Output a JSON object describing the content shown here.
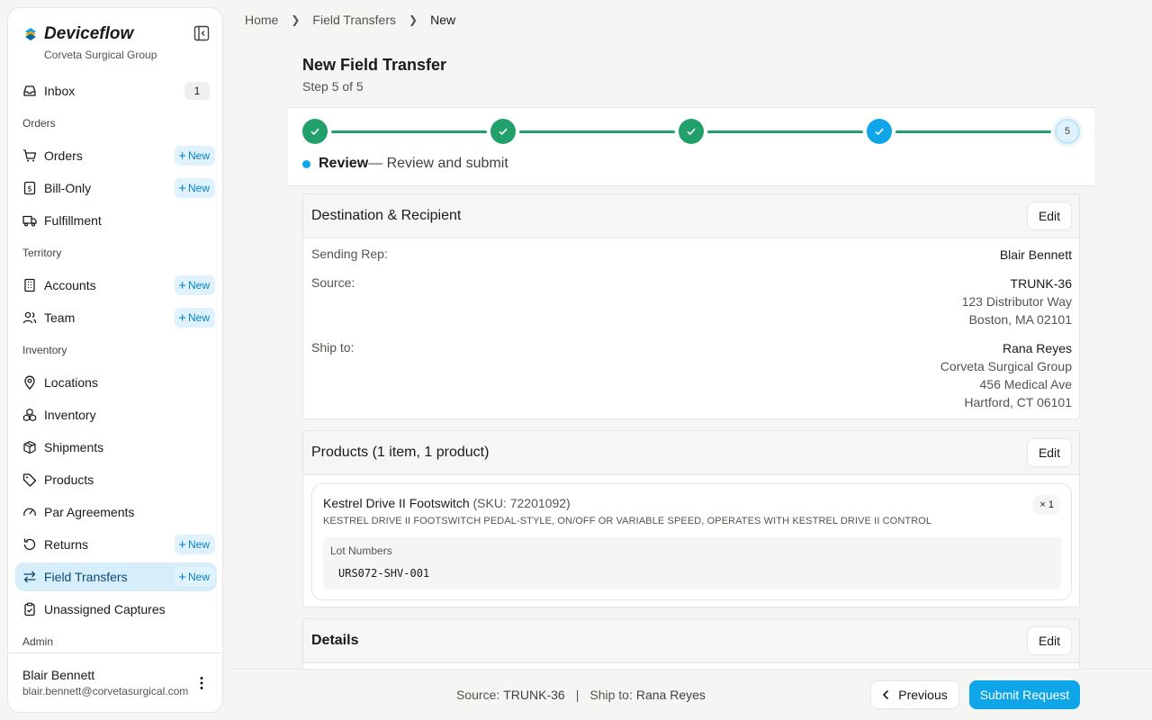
{
  "app": {
    "name": "Deviceflow",
    "org": "Corveta Surgical Group"
  },
  "sidebar": {
    "inbox": {
      "label": "Inbox",
      "count": "1"
    },
    "sections": {
      "orders": "Orders",
      "territory": "Territory",
      "inventory": "Inventory",
      "admin": "Admin"
    },
    "items": {
      "orders": "Orders",
      "bill_only": "Bill-Only",
      "fulfillment": "Fulfillment",
      "accounts": "Accounts",
      "team": "Team",
      "locations": "Locations",
      "inventory": "Inventory",
      "shipments": "Shipments",
      "products": "Products",
      "par_agreements": "Par Agreements",
      "returns": "Returns",
      "field_transfers": "Field Transfers",
      "unassigned_captures": "Unassigned Captures"
    },
    "new_label": "New",
    "active_item": "Field Transfers",
    "user": {
      "name": "Blair Bennett",
      "email": "blair.bennett@corvetasurgical.com"
    }
  },
  "breadcrumb": [
    "Home",
    "Field Transfers",
    "New"
  ],
  "page": {
    "title": "New Field Transfer",
    "step_text": "Step 5 of 5"
  },
  "stepper": {
    "current_step_number": "5",
    "current_label": "Review",
    "current_desc": "— Review and submit"
  },
  "destination_card": {
    "title": "Destination & Recipient",
    "edit_label": "Edit",
    "sending_rep_label": "Sending Rep:",
    "sending_rep": "Blair Bennett",
    "source_label": "Source:",
    "source_name": "TRUNK-36",
    "source_addr1": "123 Distributor Way",
    "source_addr2": "Boston, MA 02101",
    "ship_to_label": "Ship to:",
    "ship_to_name": "Rana Reyes",
    "ship_to_org": "Corveta Surgical Group",
    "ship_to_addr1": "456 Medical Ave",
    "ship_to_addr2": "Hartford, CT 06101"
  },
  "products_card": {
    "title": "Products (1 item, 1 product)",
    "edit_label": "Edit",
    "product": {
      "name": "Kestrel Drive II Footswitch",
      "sku": "(SKU: 72201092)",
      "description": "KESTREL DRIVE II FOOTSWITCH PEDAL-STYLE, ON/OFF OR VARIABLE SPEED, OPERATES WITH KESTREL DRIVE II CONTROL",
      "qty": "× 1",
      "lot_label": "Lot Numbers",
      "lot_number": "URS072-SHV-001"
    }
  },
  "details_card": {
    "title": "Details",
    "edit_label": "Edit"
  },
  "footer": {
    "source_label": "Source:",
    "source_value": "TRUNK-36",
    "ship_label": "Ship to:",
    "ship_value": "Rana Reyes",
    "previous_label": "Previous",
    "submit_label": "Submit Request"
  },
  "colors": {
    "accent": "#0ea5e9",
    "success": "#22a06b",
    "active_nav_bg": "#d6eef9"
  }
}
